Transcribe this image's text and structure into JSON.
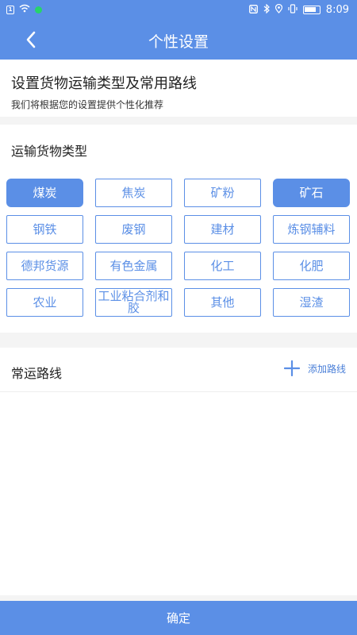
{
  "status_bar": {
    "time": "8:09",
    "left_icons": [
      "sim-icon",
      "wifi-icon",
      "app-notification-icon"
    ],
    "right_icons": [
      "nfc-icon",
      "bluetooth-icon",
      "location-icon",
      "vibrate-icon",
      "battery-icon"
    ]
  },
  "header": {
    "title": "个性设置"
  },
  "intro": {
    "title": "设置货物运输类型及常用路线",
    "subtitle": "我们将根据您的设置提供个性化推荐"
  },
  "cargo": {
    "title": "运输货物类型",
    "items": [
      {
        "label": "煤炭",
        "selected": true
      },
      {
        "label": "焦炭",
        "selected": false
      },
      {
        "label": "矿粉",
        "selected": false
      },
      {
        "label": "矿石",
        "selected": true
      },
      {
        "label": "钢铁",
        "selected": false
      },
      {
        "label": "废钢",
        "selected": false
      },
      {
        "label": "建材",
        "selected": false
      },
      {
        "label": "炼钢辅料",
        "selected": false
      },
      {
        "label": "德邦货源",
        "selected": false
      },
      {
        "label": "有色金属",
        "selected": false
      },
      {
        "label": "化工",
        "selected": false
      },
      {
        "label": "化肥",
        "selected": false
      },
      {
        "label": "农业",
        "selected": false
      },
      {
        "label": "工业粘合剂和胶",
        "selected": false
      },
      {
        "label": "其他",
        "selected": false
      },
      {
        "label": "湿渣",
        "selected": false
      }
    ]
  },
  "routes": {
    "title": "常运路线",
    "add_label": "添加路线"
  },
  "footer": {
    "confirm_label": "确定"
  },
  "colors": {
    "primary": "#5b8fe6",
    "background": "#f4f4f4"
  }
}
